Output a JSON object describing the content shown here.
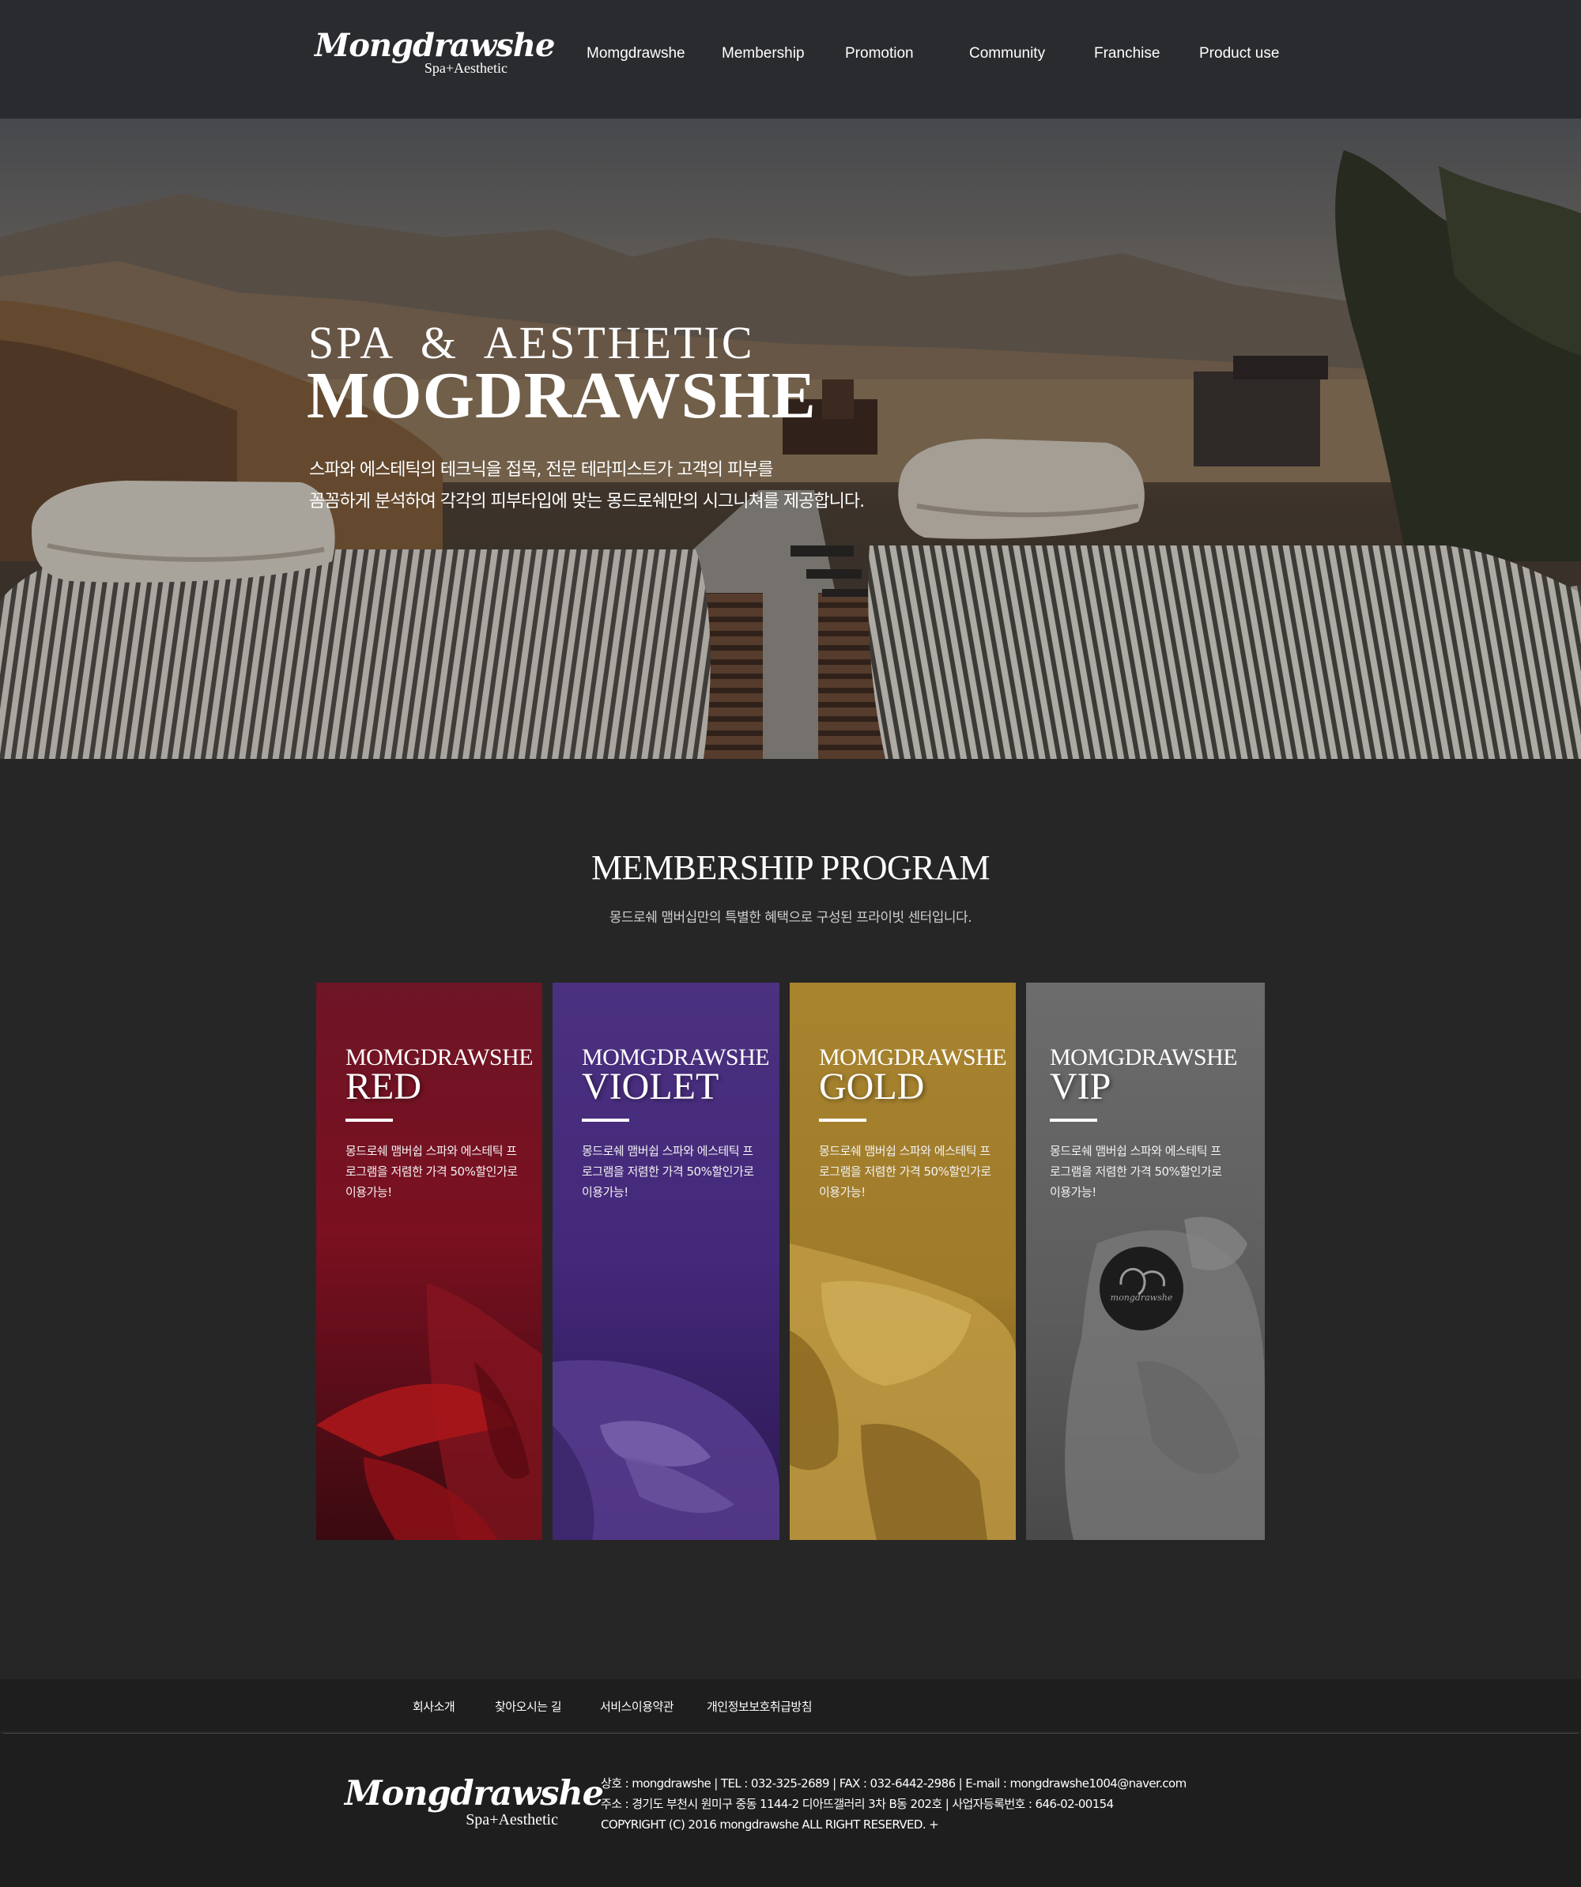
{
  "brand": {
    "logo_script": "Mongdrawshe",
    "logo_tag": "Spa+Aesthetic"
  },
  "nav": {
    "items": [
      "Momgdrawshe",
      "Membership",
      "Promotion",
      "Community",
      "Franchise",
      "Product use"
    ]
  },
  "hero": {
    "kicker": "SPA  &  AESTHETIC",
    "title": "MOGDRAWSHE",
    "line1": "스파와 에스테틱의 테크닉을 접목, 전문 테라피스트가 고객의 피부를",
    "line2": "꼼꼼하게 분석하여 각각의 피부타입에 맞는 몽드로쉐만의 시그니쳐를 제공합니다."
  },
  "membership": {
    "title": "MEMBERSHIP PROGRAM",
    "subtitle": "몽드로쉐 맴버십만의 특별한 혜택으로 구성된 프라이빗 센터입니다.",
    "cards": [
      {
        "brand": "MOMGDRAWSHE",
        "tier": "RED",
        "desc1": "몽드로쉐 맴버쉽 스파와 에스테틱 프",
        "desc2": "로그램을 저렴한 가격 50%할인가로",
        "desc3": "이용가능!",
        "color": "#7a1424"
      },
      {
        "brand": "MOMGDRAWSHE",
        "tier": "VIOLET",
        "desc1": "몽드로쉐 맴버쉽 스파와 에스테틱 프",
        "desc2": "로그램을 저렴한 가격 50%할인가로",
        "desc3": "이용가능!",
        "color": "#4a2e7e"
      },
      {
        "brand": "MOMGDRAWSHE",
        "tier": "GOLD",
        "desc1": "몽드로쉐 맴버쉽 스파와 에스테틱 프",
        "desc2": "로그램을 저렴한 가격 50%할인가로",
        "desc3": "이용가능!",
        "color": "#a8832e"
      },
      {
        "brand": "MOMGDRAWSHE",
        "tier": "VIP",
        "desc1": "몽드로쉐 맴버쉽 스파와 에스테틱 프",
        "desc2": "로그램을 저렴한 가격 50%할인가로",
        "desc3": "이용가능!",
        "color": "#6a6a6a"
      }
    ],
    "vip_badge_text": "mongdrawshe"
  },
  "footer": {
    "links": [
      "회사소개",
      "찾아오시는 길",
      "서비스이용약관",
      "개인정보보호취급방침"
    ],
    "info1": "상호 : mongdrawshe  |  TEL : 032-325-2689  |  FAX : 032-6442-2986  |  E-mail : mongdrawshe1004@naver.com",
    "info2": "주소 : 경기도 부천시 원미구 중동 1144-2 디아뜨갤러리 3차 B동 202호  |  사업자등록번호 : 646-02-00154",
    "info3": "COPYRIGHT (C) 2016 mongdrawshe ALL RIGHT RESERVED. +"
  }
}
